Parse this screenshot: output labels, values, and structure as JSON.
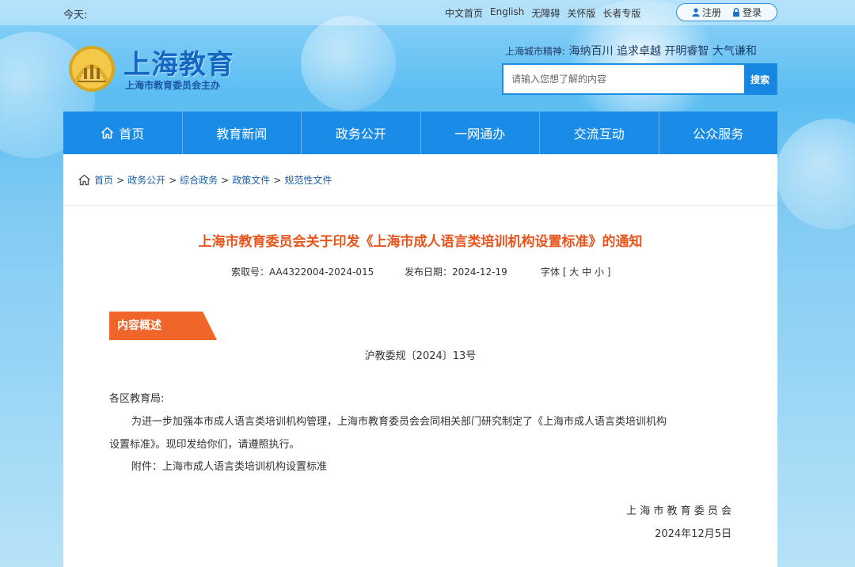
{
  "topbar": {
    "today_label": "今天:",
    "links": [
      "中文首页",
      "English",
      "无障碍",
      "关怀版",
      "长者专版"
    ],
    "register_label": "注册",
    "login_label": "登录"
  },
  "header": {
    "site_title": "上海教育",
    "site_subtitle": "上海市教育委员会主办",
    "spirit_label": "上海城市精神:",
    "spirit_text": "海纳百川 追求卓越 开明睿智 大气谦和",
    "search": {
      "placeholder": "请输入您想了解的内容",
      "button_label": "搜索"
    }
  },
  "nav": {
    "items": [
      "首页",
      "教育新闻",
      "政务公开",
      "一网通办",
      "交流互动",
      "公众服务"
    ]
  },
  "breadcrumb": {
    "items": [
      "首页",
      "政务公开",
      "综合政务",
      "政策文件",
      "规范性文件"
    ],
    "separator": ">"
  },
  "article": {
    "title": "上海市教育委员会关于印发《上海市成人语言类培训机构设置标准》的通知",
    "index_no": "索取号：AA4322004-2024-015",
    "publish_date": "发布日期：2024-12-19",
    "font_size_label": "字体 [ 大 中 小 ]",
    "section_tag": "内容概述",
    "doc_number": "沪教委规〔2024〕13号",
    "salutation": "各区教育局:",
    "paragraph_line1": "为进一步加强本市成人语言类培训机构管理，上海市教育委员会会同相关部门研究制定了《上海市成人语言类培训机构",
    "paragraph_line2": "设置标准》。现印发给你们，请遵照执行。",
    "attachment": "附件：上海市成人语言类培训机构设置标准",
    "signer": "上 海 市 教 育 委 员 会",
    "sign_date": "2024年12月5日"
  },
  "colors": {
    "nav_bg": "#1a8ce8",
    "title_orange": "#e8551c",
    "tag_orange": "#f0652a",
    "link_blue": "#1a5fa8"
  }
}
